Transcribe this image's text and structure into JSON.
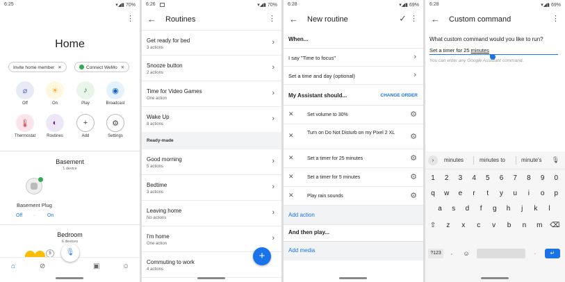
{
  "panels": {
    "home": {
      "status": {
        "time": "6:25",
        "battery": "70%"
      },
      "title": "Home",
      "chips": [
        {
          "label": "Invite home member"
        },
        {
          "label": "Connect WeMo"
        }
      ],
      "tiles": [
        {
          "label": "Off",
          "icon": "bulb-off-icon"
        },
        {
          "label": "On",
          "icon": "bulb-on-icon"
        },
        {
          "label": "Play",
          "icon": "music-icon"
        },
        {
          "label": "Broadcast",
          "icon": "broadcast-icon"
        },
        {
          "label": "Thermostat",
          "icon": "thermometer-icon"
        },
        {
          "label": "Routines",
          "icon": "routines-icon"
        },
        {
          "label": "Add",
          "icon": "plus-icon"
        },
        {
          "label": "Settings",
          "icon": "gear-icon"
        }
      ],
      "rooms": [
        {
          "name": "Basement",
          "devices": "1 device"
        },
        {
          "name": "Bedroom",
          "devices": "6 devices"
        }
      ],
      "device": {
        "name": "Basement Plug",
        "off_label": "Off",
        "on_label": "On"
      },
      "avatar_count": "5"
    },
    "routines": {
      "status": {
        "time": "6:26",
        "battery": "70%"
      },
      "title": "Routines",
      "items": [
        {
          "title": "Get ready for bed",
          "subtitle": "3 actions"
        },
        {
          "title": "Snooze button",
          "subtitle": "2 actions"
        },
        {
          "title": "Time for Video Games",
          "subtitle": "One action"
        },
        {
          "title": "Wake Up",
          "subtitle": "8 actions"
        }
      ],
      "section": "Ready-made",
      "ready": [
        {
          "title": "Good morning",
          "subtitle": "5 actions"
        },
        {
          "title": "Bedtime",
          "subtitle": "3 actions"
        },
        {
          "title": "Leaving home",
          "subtitle": "No actions"
        },
        {
          "title": "I'm home",
          "subtitle": "One action"
        },
        {
          "title": "Commuting to work",
          "subtitle": "4 actions"
        }
      ],
      "fab": "+"
    },
    "new_routine": {
      "status": {
        "time": "6:28",
        "battery": "69%"
      },
      "title": "New routine",
      "when_label": "When...",
      "triggers": [
        "I say \"Time to focus\"",
        "Set a time and day (optional)"
      ],
      "should_label": "My Assistant should...",
      "change_order": "CHANGE ORDER",
      "actions": [
        "Set volume to 30%",
        "Turn on Do Not Disturb on my Pixel 2 XL",
        "Set a timer for 25 minutes",
        "Set a timer for 5 minutes",
        "Play rain sounds"
      ],
      "add_action": "Add action",
      "then_play": "And then play...",
      "add_media": "Add media"
    },
    "custom_command": {
      "status": {
        "time": "6:28",
        "battery": "69%"
      },
      "title": "Custom command",
      "question": "What custom command would you like to run?",
      "value_prefix": "Set a timer for 25 ",
      "value_underlined": "minutes",
      "hint": "You can enter any Google Assistant command.",
      "suggestions": [
        "minutes",
        "minutes to",
        "minute's"
      ],
      "keyboard": {
        "row1": [
          "1",
          "2",
          "3",
          "4",
          "5",
          "6",
          "7",
          "8",
          "9",
          "0"
        ],
        "row2": [
          "q",
          "w",
          "e",
          "r",
          "t",
          "y",
          "u",
          "i",
          "o",
          "p"
        ],
        "row3": [
          "a",
          "s",
          "d",
          "f",
          "g",
          "h",
          "j",
          "k",
          "l"
        ],
        "row4": [
          "⇧",
          "z",
          "x",
          "c",
          "v",
          "b",
          "n",
          "m",
          "⌫"
        ],
        "fn_label": "?123",
        "comma": ",",
        "emoji": "☺",
        "period": ".",
        "enter": "↵"
      }
    }
  }
}
